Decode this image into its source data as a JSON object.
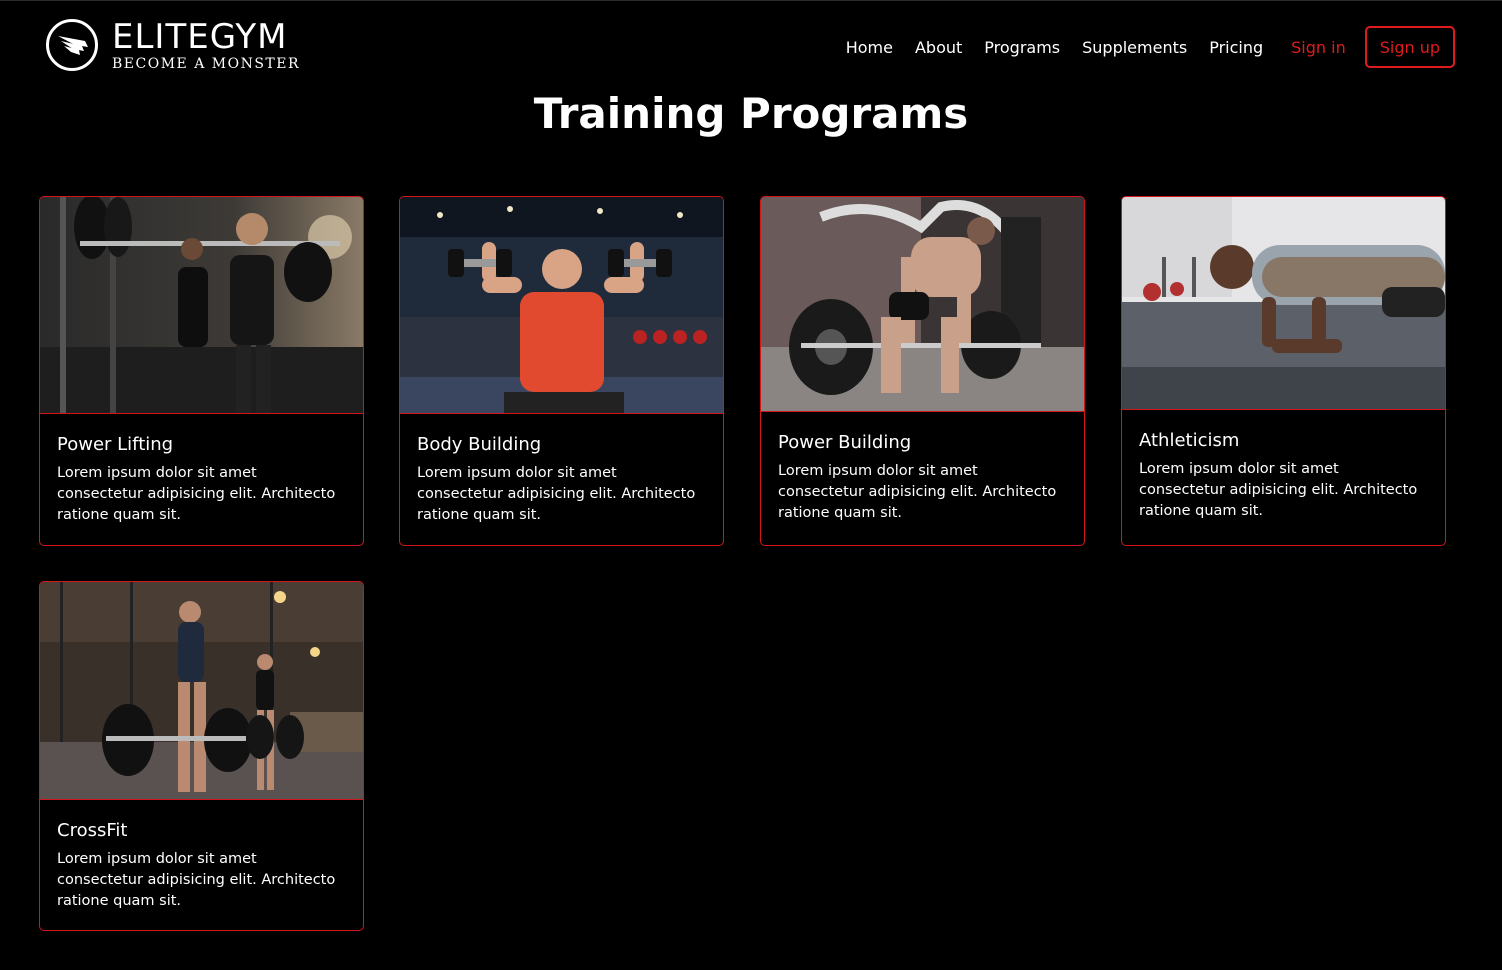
{
  "header": {
    "brand": "ELITEGYM",
    "tagline": "BECOME A MONSTER",
    "nav": [
      "Home",
      "About",
      "Programs",
      "Supplements",
      "Pricing"
    ],
    "signin_label": "Sign in",
    "signup_label": "Sign up"
  },
  "main": {
    "title": "Training Programs",
    "cards": [
      {
        "title": "Power Lifting",
        "description": "Lorem ipsum dolor sit amet consectetur adipisicing elit. Architecto ratione quam sit."
      },
      {
        "title": "Body Building",
        "description": "Lorem ipsum dolor sit amet consectetur adipisicing elit. Architecto ratione quam sit."
      },
      {
        "title": "Power Building",
        "description": "Lorem ipsum dolor sit amet consectetur adipisicing elit. Architecto ratione quam sit."
      },
      {
        "title": "Athleticism",
        "description": "Lorem ipsum dolor sit amet consectetur adipisicing elit. Architecto ratione quam sit."
      },
      {
        "title": "CrossFit",
        "description": "Lorem ipsum dolor sit amet consectetur adipisicing elit. Architecto ratione quam sit."
      }
    ]
  },
  "colors": {
    "background": "#000000",
    "accent": "#e01b1b",
    "text": "#ffffff"
  },
  "icons": {
    "logo": "wing-icon"
  }
}
